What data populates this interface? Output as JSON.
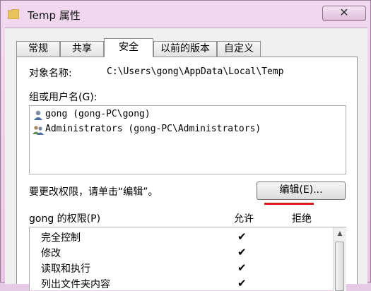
{
  "window": {
    "title": "Temp 属性",
    "close_label": "✕"
  },
  "tabs": [
    {
      "label": "常规",
      "active": false
    },
    {
      "label": "共享",
      "active": false
    },
    {
      "label": "安全",
      "active": true
    },
    {
      "label": "以前的版本",
      "active": false
    },
    {
      "label": "自定义",
      "active": false
    }
  ],
  "security": {
    "object_label": "对象名称:",
    "object_path": "C:\\Users\\gong\\AppData\\Local\\Temp",
    "group_label": "组或用户名(G):",
    "users": [
      {
        "name": "gong (gong-PC\\gong)",
        "icon": "user-icon"
      },
      {
        "name": "Administrators (gong-PC\\Administrators)",
        "icon": "group-icon"
      }
    ],
    "change_hint": "要更改权限，请单击“编辑”。",
    "edit_label": "编辑(E)...",
    "perm_label": "gong 的权限(P)",
    "allow_header": "允许",
    "deny_header": "拒绝",
    "permissions": [
      {
        "name": "完全控制",
        "allow": "✔",
        "deny": ""
      },
      {
        "name": "修改",
        "allow": "✔",
        "deny": ""
      },
      {
        "name": "读取和执行",
        "allow": "✔",
        "deny": ""
      },
      {
        "name": "列出文件夹内容",
        "allow": "✔",
        "deny": ""
      }
    ]
  },
  "colors": {
    "accent_underline": "#d81b1b"
  }
}
